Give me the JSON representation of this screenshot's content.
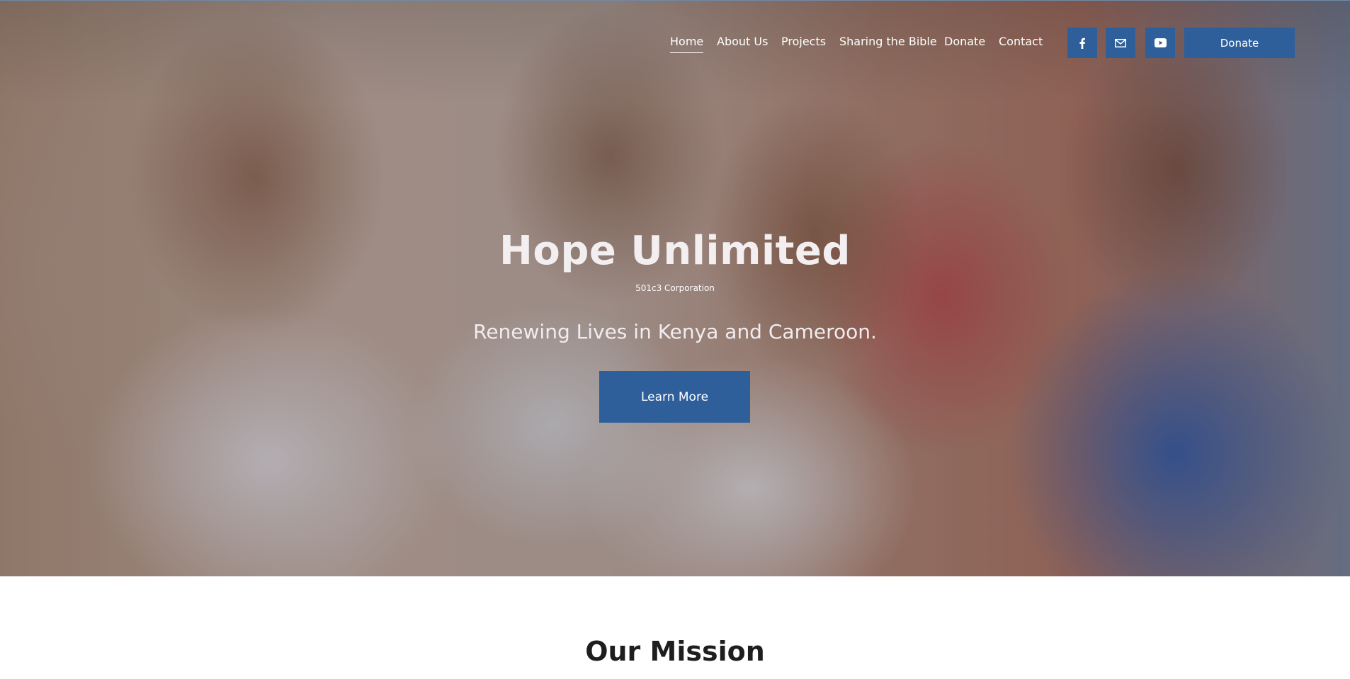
{
  "nav": {
    "links": [
      "Home",
      "About Us",
      "Projects",
      "Sharing the Bible",
      "Donate",
      "Contact"
    ],
    "active": "Home",
    "donate_button": "Donate"
  },
  "social": {
    "icons": [
      "facebook-icon",
      "email-icon",
      "youtube-icon"
    ]
  },
  "hero": {
    "title": "Hope Unlimited",
    "subtitle": "501c3 Corporation",
    "tagline": "Renewing Lives in Kenya and Cameroon.",
    "button": "Learn More"
  },
  "mission": {
    "title": "Our Mission"
  },
  "colors": {
    "accent": "#2e5f9b",
    "text_light": "#ffffff",
    "text_dark": "#1e1e1e"
  }
}
